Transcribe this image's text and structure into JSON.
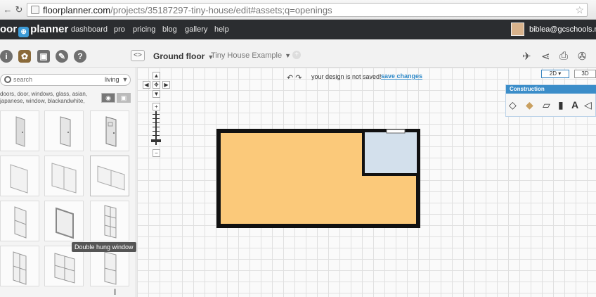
{
  "browser": {
    "url_main": "floorplanner.com",
    "url_rest": "/projects/35187297-tiny-house/edit#assets;q=openings"
  },
  "nav": {
    "logo_left": "oor",
    "logo_mark": "⊕",
    "logo_right": "planner",
    "links": [
      "dashboard",
      "pro",
      "pricing",
      "blog",
      "gallery",
      "help"
    ],
    "user_email": "biblea@gcschools.net"
  },
  "toolbar": {
    "arrows": "<>",
    "floor": "Ground floor",
    "project": "Tiny House Example",
    "add_floor": "+"
  },
  "sidebar": {
    "search_placeholder": "search",
    "category": "living",
    "tags": "doors, door, windows, glass, asian, japanese, window, blackandwhite,",
    "tooltip": "Double hung window"
  },
  "canvas": {
    "undo": "↶",
    "redo": "↷",
    "status": "your design is not saved!",
    "save_link": "save changes",
    "view_2d": "2D",
    "view_3d": "3D",
    "zoom_in": "+",
    "zoom_out": "−",
    "pan_up": "▲",
    "pan_down": "▼",
    "pan_left": "◀",
    "pan_right": "▶",
    "pan_center": "✥"
  },
  "construction": {
    "title": "Construction",
    "text_tool": "A"
  },
  "colors": {
    "room_main": "#fbc97a",
    "room_small": "#d3e0ec",
    "wall": "#111111",
    "accent": "#3b8dc9"
  }
}
